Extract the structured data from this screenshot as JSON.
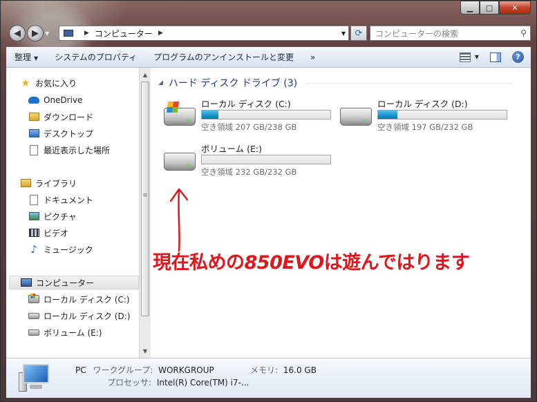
{
  "window": {
    "controls": {
      "minimize": "▁",
      "maximize": "□",
      "close": "✕"
    }
  },
  "address": {
    "back_icon": "back-arrow-icon",
    "forward_icon": "forward-arrow-icon",
    "path": "コンピューター",
    "search_placeholder": "コンピューターの検索"
  },
  "toolbar": {
    "organize": "整理",
    "system_properties": "システムのプロパティ",
    "uninstall": "プログラムのアンインストールと変更",
    "more": "»"
  },
  "sidebar": {
    "favorites": "お気に入り",
    "favorite_items": [
      "OneDrive",
      "ダウンロード",
      "デスクトップ",
      "最近表示した場所"
    ],
    "libraries": "ライブラリ",
    "library_items": [
      "ドキュメント",
      "ピクチャ",
      "ビデオ",
      "ミュージック"
    ],
    "computer": "コンピューター",
    "computer_items": [
      "ローカル ディスク (C:)",
      "ローカル ディスク (D:)",
      "ボリューム (E:)"
    ]
  },
  "main": {
    "group_title": "ハード ディスク ドライブ (3)",
    "drives": [
      {
        "name": "ローカル ディスク (C:)",
        "free": "空き領域 207 GB/238 GB",
        "used_fraction": 0.13
      },
      {
        "name": "ローカル ディスク (D:)",
        "free": "空き領域 197 GB/232 GB",
        "used_fraction": 0.15
      },
      {
        "name": "ボリューム (E:)",
        "free": "空き領域 232 GB/232 GB",
        "used_fraction": 0.0
      }
    ],
    "annotation_part1": "現在私めの",
    "annotation_part2": "850EVO",
    "annotation_part3": "は遊んではります"
  },
  "details": {
    "name": "PC",
    "workgroup_label": "ワークグループ:",
    "workgroup_value": "WORKGROUP",
    "memory_label": "メモリ:",
    "memory_value": "16.0 GB",
    "processor_label": "プロセッサ:",
    "processor_value": "Intel(R) Core(TM) i7-..."
  },
  "colors": {
    "accent": "#1e3a8a",
    "bar_fill": "#1892c8",
    "annotation": "#e0161b"
  }
}
